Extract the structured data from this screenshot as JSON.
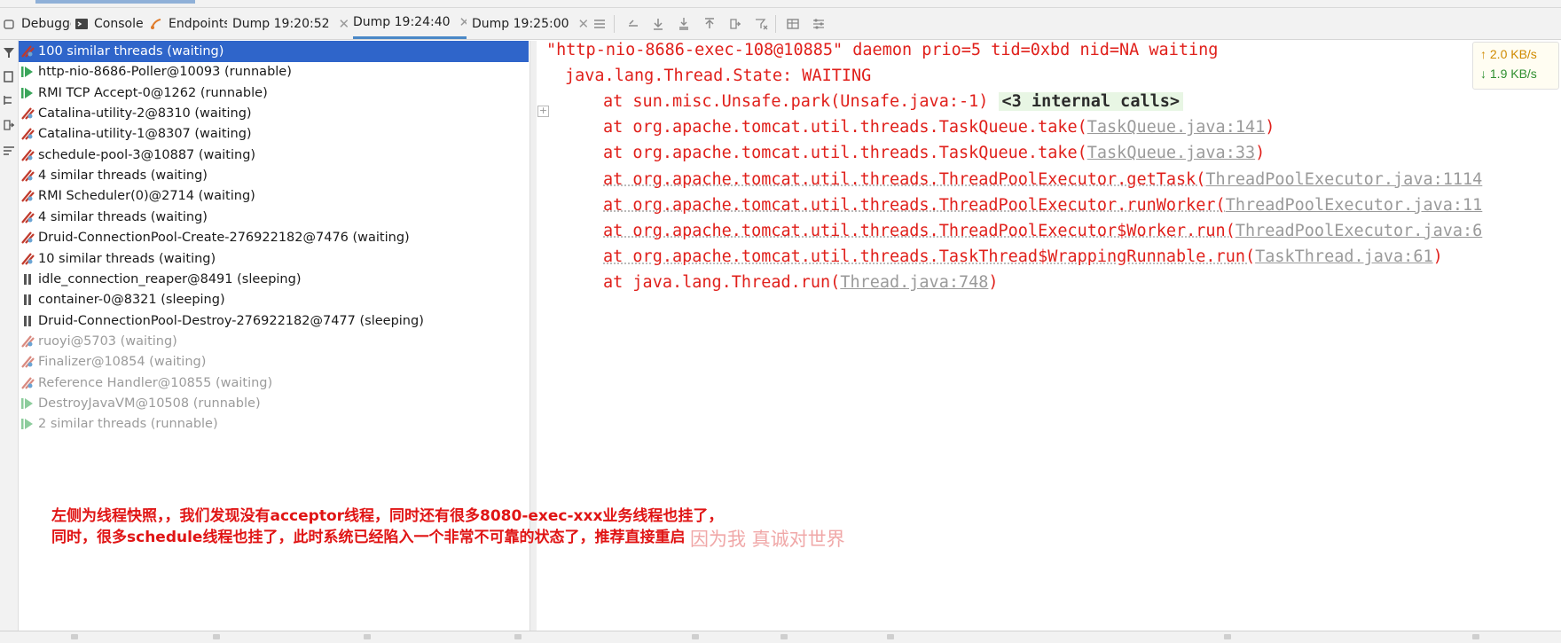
{
  "tabs": [
    {
      "label": "Debugger",
      "icon": "debugger-icon"
    },
    {
      "label": "Console",
      "icon": "console-icon"
    },
    {
      "label": "Endpoints",
      "icon": "endpoints-icon"
    },
    {
      "label": "Dump 19:20:52",
      "closable": true
    },
    {
      "label": "Dump 19:24:40",
      "closable": true,
      "active": true
    },
    {
      "label": "Dump 19:25:00",
      "closable": true
    }
  ],
  "toolbar_icons": [
    "lines-icon",
    "restore-icon",
    "download-icon",
    "download-all-icon",
    "upload-icon",
    "export-icon",
    "filter-clear-icon",
    "table-icon",
    "settings-lines-icon"
  ],
  "left_toolbar_icons": [
    "filter-icon",
    "copy-icon",
    "tree-icon",
    "export-icon",
    "sort-icon"
  ],
  "threads": [
    {
      "label": "100 similar threads (waiting)",
      "state": "waiting",
      "selected": true
    },
    {
      "label": "http-nio-8686-Poller@10093 (runnable)",
      "state": "runnable"
    },
    {
      "label": "RMI TCP Accept-0@1262 (runnable)",
      "state": "runnable"
    },
    {
      "label": "Catalina-utility-2@8310 (waiting)",
      "state": "waiting"
    },
    {
      "label": "Catalina-utility-1@8307 (waiting)",
      "state": "waiting"
    },
    {
      "label": "schedule-pool-3@10887 (waiting)",
      "state": "waiting"
    },
    {
      "label": "4 similar threads (waiting)",
      "state": "waiting"
    },
    {
      "label": "RMI Scheduler(0)@2714 (waiting)",
      "state": "waiting"
    },
    {
      "label": "4 similar threads (waiting)",
      "state": "waiting"
    },
    {
      "label": "Druid-ConnectionPool-Create-276922182@7476 (waiting)",
      "state": "waiting"
    },
    {
      "label": "10 similar threads (waiting)",
      "state": "waiting"
    },
    {
      "label": "idle_connection_reaper@8491 (sleeping)",
      "state": "sleeping"
    },
    {
      "label": "container-0@8321 (sleeping)",
      "state": "sleeping"
    },
    {
      "label": "Druid-ConnectionPool-Destroy-276922182@7477 (sleeping)",
      "state": "sleeping"
    },
    {
      "label": "ruoyi@5703 (waiting)",
      "state": "waiting",
      "dim": true
    },
    {
      "label": "Finalizer@10854 (waiting)",
      "state": "waiting",
      "dim": true
    },
    {
      "label": "Reference Handler@10855 (waiting)",
      "state": "waiting",
      "dim": true
    },
    {
      "label": "DestroyJavaVM@10508 (runnable)",
      "state": "runnable",
      "dim": true
    },
    {
      "label": "2 similar threads (runnable)",
      "state": "runnable",
      "dim": true
    }
  ],
  "dump": {
    "header": "\"http-nio-8686-exec-108@10885\" daemon prio=5 tid=0xbd nid=NA waiting",
    "state_line": "java.lang.Thread.State: WAITING",
    "frames": [
      {
        "prefix": "at sun.misc.Unsafe.park(Unsafe.java:-1) ",
        "internal": "<3 internal calls>"
      },
      {
        "prefix": "at org.apache.tomcat.util.threads.TaskQueue.take(",
        "link": "TaskQueue.java:141",
        "suffix": ")"
      },
      {
        "prefix": "at org.apache.tomcat.util.threads.TaskQueue.take(",
        "link": "TaskQueue.java:33",
        "suffix": ")"
      },
      {
        "prefix": "at org.apache.tomcat.util.threads.ThreadPoolExecutor.getTask(",
        "link": "ThreadPoolExecutor.java:1114",
        "suffix": "",
        "dotted": true
      },
      {
        "prefix": "at org.apache.tomcat.util.threads.ThreadPoolExecutor.runWorker(",
        "link": "ThreadPoolExecutor.java:11",
        "suffix": "",
        "dotted": true
      },
      {
        "prefix": "at org.apache.tomcat.util.threads.ThreadPoolExecutor$Worker.run(",
        "link": "ThreadPoolExecutor.java:6",
        "suffix": "",
        "dotted": true
      },
      {
        "prefix": "at org.apache.tomcat.util.threads.TaskThread$WrappingRunnable.run(",
        "link": "TaskThread.java:61",
        "suffix": ")",
        "dotted": true
      },
      {
        "prefix": "at java.lang.Thread.run(",
        "link": "Thread.java:748",
        "suffix": ")"
      }
    ]
  },
  "network": {
    "up": "↑ 2.0 KB/s",
    "down": "↓ 1.9 KB/s",
    "up_color": "#d08a00",
    "down_color": "#2f8f2f"
  },
  "annotation": {
    "line1": "左侧为线程快照，，我们发现没有acceptor线程，同时还有很多8080-exec-xxx业务线程也挂了，",
    "line2": "同时，很多schedule线程也挂了，此时系统已经陷入一个非常不可靠的状态了，推荐直接重启"
  },
  "watermark": "因为我 真诚对世界",
  "colors": {
    "selection": "#2f65ca",
    "dump_text": "#e0201b",
    "annotation": "#e01515",
    "waiting_icon": "#c0392b",
    "runnable_icon": "#3aa55a",
    "sleeping_icon": "#555555"
  }
}
